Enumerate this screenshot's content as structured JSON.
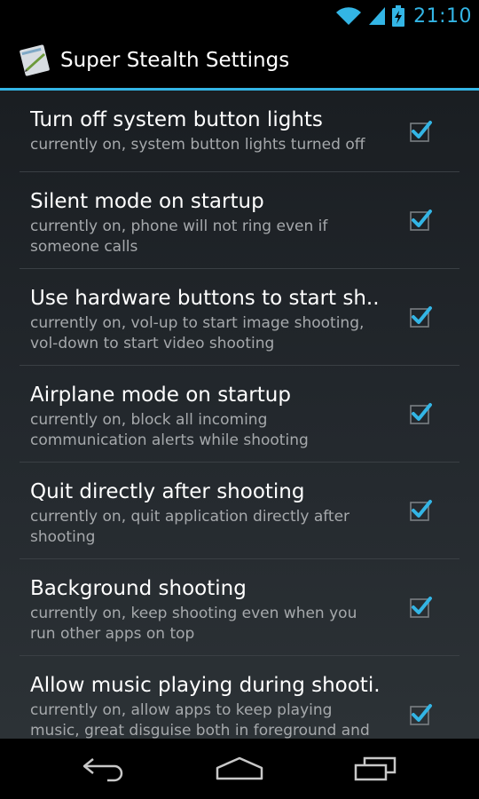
{
  "status_bar": {
    "time": "21:10",
    "icons": [
      "wifi-icon",
      "signal-icon",
      "battery-charging-icon"
    ]
  },
  "action_bar": {
    "title": "Super Stealth Settings",
    "icon": "app-note-icon"
  },
  "settings": [
    {
      "title": "Turn off system button lights",
      "summary": "currently on, system button lights turned off",
      "checked": true
    },
    {
      "title": "Silent mode on startup",
      "summary": "currently on, phone will not ring even if someone calls",
      "checked": true
    },
    {
      "title": "Use hardware buttons to start sh..",
      "summary": "currently on, vol-up to start image shooting, vol-down to start video shooting",
      "checked": true
    },
    {
      "title": "Airplane mode on startup",
      "summary": "currently on, block all incoming communication alerts while shooting",
      "checked": true
    },
    {
      "title": "Quit directly after shooting",
      "summary": "currently on, quit application directly after shooting",
      "checked": true
    },
    {
      "title": "Background shooting",
      "summary": "currently on, keep shooting even when you run other apps on top",
      "checked": true
    },
    {
      "title": "Allow music playing during shooti..",
      "summary": "currently on, allow apps to keep playing music, great disguise both in foreground and background mode",
      "checked": true
    }
  ],
  "nav_bar": {
    "buttons": [
      "back-icon",
      "home-icon",
      "recent-apps-icon"
    ]
  },
  "colors": {
    "accent": "#33b5e5",
    "check": "#33b5e5",
    "text_primary": "#ffffff",
    "text_secondary": "#a6a9ac"
  }
}
